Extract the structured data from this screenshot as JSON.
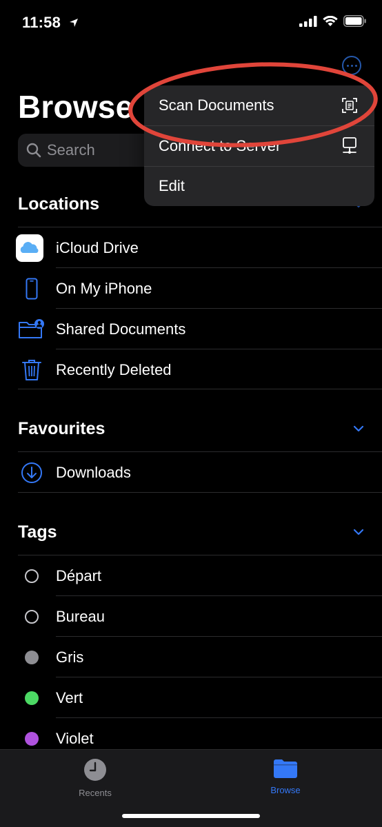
{
  "status_bar": {
    "time": "11:58"
  },
  "header": {
    "title": "Browse"
  },
  "search": {
    "placeholder": "Search"
  },
  "menu": {
    "items": [
      {
        "label": "Scan Documents",
        "icon": "scan-document-icon"
      },
      {
        "label": "Connect to Server",
        "icon": "server-icon"
      },
      {
        "label": "Edit"
      }
    ]
  },
  "locations": {
    "title": "Locations",
    "items": [
      {
        "label": "iCloud Drive",
        "icon": "icloud-icon"
      },
      {
        "label": "On My iPhone",
        "icon": "iphone-icon"
      },
      {
        "label": "Shared Documents",
        "icon": "shared-folder-icon"
      },
      {
        "label": "Recently Deleted",
        "icon": "trash-icon"
      }
    ]
  },
  "favourites": {
    "title": "Favourites",
    "items": [
      {
        "label": "Downloads",
        "icon": "download-icon"
      }
    ]
  },
  "tags": {
    "title": "Tags",
    "items": [
      {
        "label": "Départ",
        "color": "outline"
      },
      {
        "label": "Bureau",
        "color": "outline"
      },
      {
        "label": "Gris",
        "color": "#8e8e93"
      },
      {
        "label": "Vert",
        "color": "#4cd964"
      },
      {
        "label": "Violet",
        "color": "#af52de"
      }
    ]
  },
  "tab_bar": {
    "tabs": [
      {
        "label": "Recents",
        "icon": "clock-icon",
        "active": false
      },
      {
        "label": "Browse",
        "icon": "folder-icon",
        "active": true
      }
    ]
  },
  "colors": {
    "accent": "#3478f6",
    "annotation": "#e0453a",
    "background": "#000000"
  }
}
